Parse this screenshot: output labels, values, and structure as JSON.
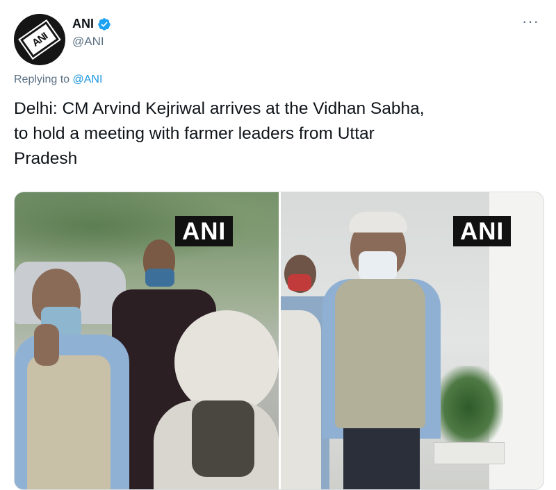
{
  "tweet": {
    "author_name": "ANI",
    "author_handle": "@ANI",
    "verified_icon": "verified-badge-icon",
    "more_icon": "more-options-icon",
    "reply_prefix": "Replying to",
    "reply_handle": "@ANI",
    "text_line1": "Delhi: CM Arvind Kejriwal arrives at the Vidhan Sabha,",
    "text_line2": "to hold a meeting with farmer leaders from Uttar",
    "text_line3": "Pradesh"
  },
  "avatar": {
    "logo_text": "ANI"
  },
  "media": {
    "left_watermark": "ANI",
    "right_watermark": "ANI"
  },
  "colors": {
    "link": "#1b95e0",
    "secondary_text": "#5b7083",
    "verified": "#1da1f2"
  }
}
